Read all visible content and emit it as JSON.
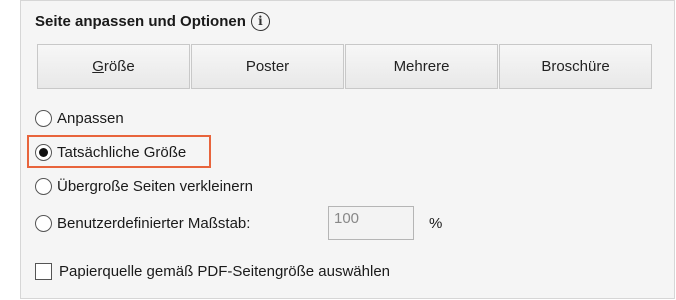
{
  "header": {
    "title": "Seite anpassen und Optionen",
    "info_icon": "info-icon"
  },
  "tabs": [
    {
      "label_underlined": "G",
      "label_rest": "röße"
    },
    {
      "label": "Poster"
    },
    {
      "label": "Mehrere"
    },
    {
      "label": "Broschüre"
    }
  ],
  "options": {
    "fit": {
      "label": "Anpassen",
      "selected": false
    },
    "actual": {
      "label": "Tatsächliche Größe",
      "selected": true
    },
    "shrink": {
      "label": "Übergroße Seiten verkleinern",
      "selected": false
    },
    "custom": {
      "label": "Benutzerdefinierter Maßstab:",
      "selected": false
    },
    "scale": {
      "value": "100",
      "unit": "%"
    }
  },
  "paper_source": {
    "label": "Papierquelle gemäß PDF-Seitengröße auswählen",
    "checked": false
  },
  "colors": {
    "highlight": "#e8643c",
    "panel_bg": "#f5f5f5"
  }
}
